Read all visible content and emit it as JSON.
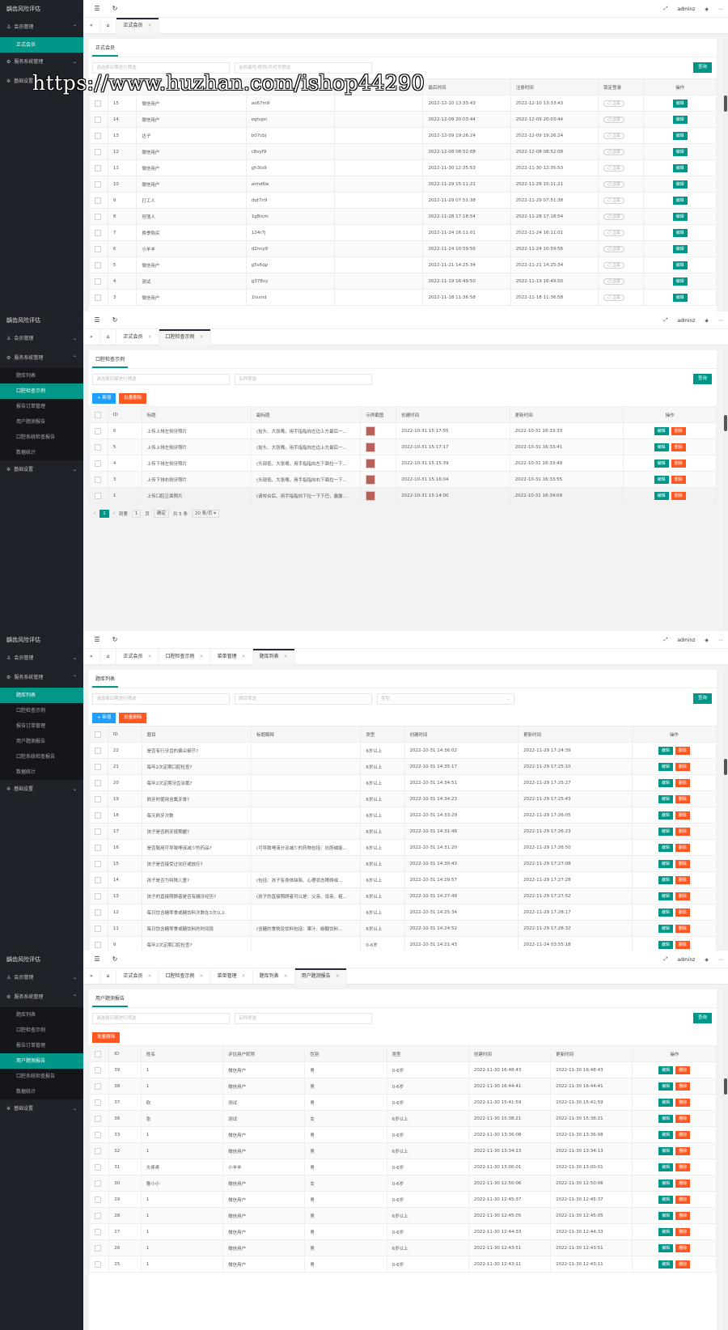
{
  "common": {
    "brand": "龋齿风险评估",
    "menu_member": "会员管理",
    "menu_service": "服务系统管理",
    "menu_basic": "基础设置",
    "user": "adminz",
    "sub_member": "正式会员",
    "sub_service": [
      "题库列表",
      "口腔检查示例",
      "报告订单管理",
      "用户题测报告",
      "口腔系统检查报告",
      "数据统计"
    ],
    "search_label": "查询",
    "add_label": "+ 新增",
    "batch_delete_label": "批量删除",
    "edit_label": "编辑",
    "delete_label": "删除",
    "action_header": "操作",
    "status_normal": "正常",
    "search_hint": "请选择日期进行筛选"
  },
  "watermark": "https://www.huzhan.com/ishop44290",
  "panel1": {
    "tabs": [
      "正式会员"
    ],
    "page_title": "正式会员",
    "filter2": "会员编号/昵称/手机号筛选",
    "headers": [
      "",
      "",
      "",
      "",
      "",
      "最后时间",
      "注册时间",
      "锁定登录",
      "操作"
    ],
    "rows": [
      [
        "15",
        "微信用户",
        "ao67m9",
        "2022-12-10 13:33:43",
        "2022-12-10 13:33:43"
      ],
      [
        "14",
        "微信用户",
        "egtupn",
        "2022-12-09 20:03:44",
        "2022-12-09 20:03:44"
      ],
      [
        "13",
        "达子",
        "b07cbj",
        "2022-12-09 19:26:24",
        "2022-12-09 19:26:24"
      ],
      [
        "12",
        "微信用户",
        "c8vyf9",
        "2022-12-08 08:52:08",
        "2022-12-08 08:52:08"
      ],
      [
        "11",
        "微信用户",
        "gh3ts9",
        "2022-11-30 12:35:53",
        "2022-11-30 12:35:53"
      ],
      [
        "10",
        "微信用户",
        "aimd6w",
        "2022-11-29 15:11:21",
        "2022-11-29 15:11:21"
      ],
      [
        "9",
        "打工人",
        "dqt7n9",
        "2022-11-29 07:51:38",
        "2022-11-29 07:51:38"
      ],
      [
        "8",
        "坦荡人",
        "1g8rcm",
        "2022-11-28 17:18:54",
        "2022-11-28 17:18:54"
      ],
      [
        "7",
        "换季购买",
        "124r7j",
        "2022-11-24 16:11:01",
        "2022-11-24 16:11:01"
      ],
      [
        "6",
        "小羊羊",
        "d2ncy9",
        "2022-11-24 10:59:56",
        "2022-11-24 10:59:56"
      ],
      [
        "5",
        "微信用户",
        "g5s6qp",
        "2022-11-21 14:25:34",
        "2022-11-21 14:25:34"
      ],
      [
        "4",
        "测试",
        "g378vy",
        "2022-11-19 16:49:50",
        "2022-11-19 16:49:50"
      ],
      [
        "3",
        "微信用户",
        "1tsxnd",
        "2022-11-18 11:36:58",
        "2022-11-18 11:36:58"
      ]
    ]
  },
  "panel2": {
    "tabs": [
      "正式会员",
      "口腔检查示例"
    ],
    "page_title": "口腔检查示例",
    "filter2": "名称筛选",
    "headers": [
      "ID",
      "标题",
      "副标题",
      "示例截图",
      "创建时间",
      "更新时间",
      "操作"
    ],
    "rows": [
      [
        "6",
        "上传上排左侧牙照片",
        "(抬头、大张嘴，用手指指向左边上方最后一...",
        "2022-10-31 15:17:55",
        "2022-10-31 16:33:33"
      ],
      [
        "5",
        "上传上排左侧牙照片",
        "(抬头、大张嘴，用手指指向左边上方最后一...",
        "2022-10-31 15:17:17",
        "2022-10-31 16:33:41"
      ],
      [
        "4",
        "上传下排左侧牙照片",
        "(头部低、大张嘴，用手指指向左下面拉一下...",
        "2022-10-31 15:15:39",
        "2022-10-31 16:33:49"
      ],
      [
        "3",
        "上传下排右侧牙照片",
        "(头部低、大张嘴，用手指指向右下面拉一下...",
        "2022-10-31 15:16:04",
        "2022-10-31 16:33:55"
      ],
      [
        "1",
        "上传口腔正面照片",
        "(请咬合后、用手指指向下拉一下下巴，露露...",
        "2022-10-31 15:14:00",
        "2022-10-31 16:34:09"
      ]
    ],
    "pager": {
      "page": "1",
      "goto_label": "到第",
      "goto_value": "1",
      "page_unit": "页",
      "confirm": "确定",
      "total": "共 5 条",
      "per_page": "20 条/页"
    }
  },
  "panel3": {
    "tabs": [
      "正式会员",
      "口腔检查示例",
      "菜单管理",
      "题库列表"
    ],
    "page_title": "题库列表",
    "filter2": "题目筛选",
    "filter3": "类型",
    "headers": [
      "ID",
      "题目",
      "标题解释",
      "类型",
      "创建时间",
      "更新时间",
      "操作"
    ],
    "rows": [
      [
        "22",
        "是否有行牙齿的偏尖细节?",
        "",
        "6岁以上",
        "2022-10-31 14:36:02",
        "2022-11-29 17:24:39"
      ],
      [
        "21",
        "每年2次定期口腔检查?",
        "",
        "6岁以上",
        "2022-10-31 14:35:17",
        "2022-11-29 17:25:10"
      ],
      [
        "20",
        "每年2次定期牙齿涂氟?",
        "",
        "6岁以上",
        "2022-10-31 14:34:51",
        "2022-11-29 17:25:27"
      ],
      [
        "19",
        "刷牙时使用含氟牙膏?",
        "",
        "6岁以上",
        "2022-10-31 14:34:23",
        "2022-11-29 17:25:43"
      ],
      [
        "18",
        "每天刷牙次数",
        "",
        "6岁以上",
        "2022-10-31 14:33:29",
        "2022-11-29 17:26:05"
      ],
      [
        "17",
        "孩子是否刷牙按期龈?",
        "",
        "6岁以上",
        "2022-10-31 14:31:48",
        "2022-11-29 17:26:23"
      ],
      [
        "16",
        "是否服用可导致唾液减少的药品?",
        "(可导致唾液分泌减少的药物包括：抗胆碱能...",
        "6岁以上",
        "2022-10-31 14:31:20",
        "2022-11-29 17:26:50"
      ],
      [
        "15",
        "孩子是否接受过化疗或放疗?",
        "",
        "6岁以上",
        "2022-10-31 14:30:43",
        "2022-11-29 17:27:08"
      ],
      [
        "14",
        "孩子是否为特殊儿童?",
        "(包括：孩子有身体缺陷、心理状态障碍或...",
        "6岁以上",
        "2022-10-31 14:29:57",
        "2022-11-29 17:27:28"
      ],
      [
        "13",
        "孩子的直接照顾者是否有龋牙经历?",
        "(孩子的直接照顾者可以是：父亲、母亲、祖...",
        "6岁以上",
        "2022-10-31 14:27:49",
        "2022-11-29 17:27:52"
      ],
      [
        "12",
        "每日饮含糖零食或糖饮料次数在3次以上",
        "",
        "6岁以上",
        "2022-10-31 14:25:34",
        "2022-11-29 17:28:17"
      ],
      [
        "11",
        "每日饮含糖零食或糖饮料的时间段",
        "(含糖的食物及饮料包括：果汁、碳酸饮料...",
        "6岁以上",
        "2022-10-31 14:24:52",
        "2022-11-29 17:28:32"
      ],
      [
        "9",
        "每年2次定期口腔检查?",
        "",
        "0-6岁",
        "2022-10-31 14:21:43",
        "2022-11-24 03:55:18"
      ]
    ]
  },
  "panel4": {
    "tabs": [
      "正式会员",
      "口腔检查示例",
      "菜单管理",
      "题库列表",
      "用户题测报告"
    ],
    "page_title": "用户题测报告",
    "filter2": "名称筛选",
    "headers": [
      "ID",
      "姓名",
      "评估用户昵称",
      "性别",
      "类型",
      "创建时间",
      "更新时间",
      "操作"
    ],
    "rows": [
      [
        "39",
        "1",
        "微信用户",
        "男",
        "0-6岁",
        "2022-11-30 16:48:43",
        "2022-11-30 16:48:43"
      ],
      [
        "38",
        "1",
        "微信用户",
        "男",
        "0-6岁",
        "2022-11-30 16:44:41",
        "2022-11-30 16:44:41"
      ],
      [
        "37",
        "砍",
        "测试",
        "男",
        "0-6岁",
        "2022-11-30 15:41:59",
        "2022-11-30 15:41:59"
      ],
      [
        "36",
        "张",
        "测试",
        "女",
        "6岁以上",
        "2022-11-30 15:38:21",
        "2022-11-30 15:38:21"
      ],
      [
        "33",
        "1",
        "微信用户",
        "男",
        "0-6岁",
        "2022-11-30 13:36:08",
        "2022-11-30 13:36:08"
      ],
      [
        "32",
        "1",
        "微信用户",
        "男",
        "6岁以上",
        "2022-11-30 13:34:13",
        "2022-11-30 13:34:13"
      ],
      [
        "31",
        "头疼疼",
        "小羊羊",
        "男",
        "0-6岁",
        "2022-11-30 13:00:01",
        "2022-11-30 13:00:01"
      ],
      [
        "30",
        "鲁小小",
        "微信用户",
        "女",
        "0-6岁",
        "2022-11-30 12:50:06",
        "2022-11-30 12:50:06"
      ],
      [
        "29",
        "1",
        "微信用户",
        "男",
        "0-6岁",
        "2022-11-30 12:45:37",
        "2022-11-30 12:45:37"
      ],
      [
        "28",
        "1",
        "微信用户",
        "男",
        "6岁以上",
        "2022-11-30 12:45:05",
        "2022-11-30 12:45:05"
      ],
      [
        "27",
        "1",
        "微信用户",
        "男",
        "0-6岁",
        "2022-11-30 12:44:33",
        "2022-11-30 12:44:33"
      ],
      [
        "26",
        "1",
        "微信用户",
        "男",
        "6岁以上",
        "2022-11-30 12:43:51",
        "2022-11-30 12:43:51"
      ],
      [
        "25",
        "1",
        "微信用户",
        "男",
        "0-6岁",
        "2022-11-30 12:43:11",
        "2022-11-30 12:43:11"
      ]
    ]
  }
}
